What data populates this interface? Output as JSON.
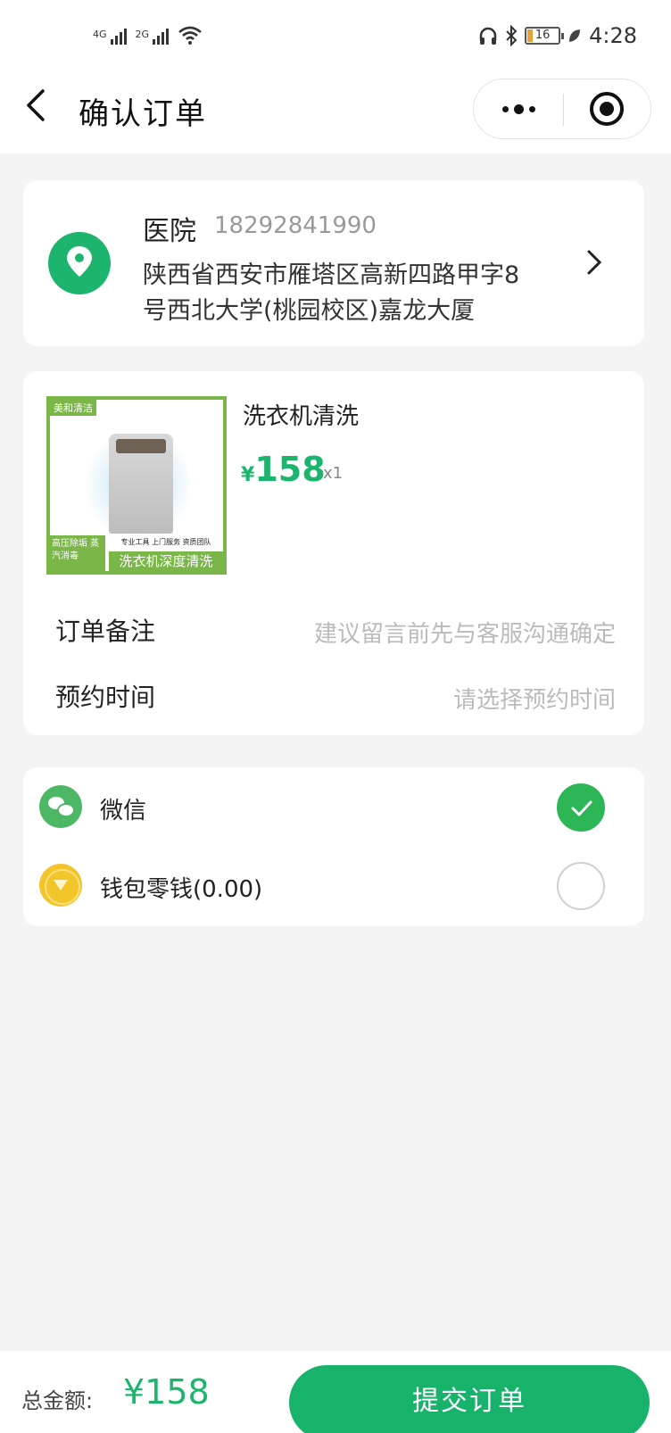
{
  "status_bar": {
    "signal1_label": "4G",
    "signal2_label": "2G",
    "battery_level": "16",
    "time": "4:28"
  },
  "nav": {
    "title": "确认订单",
    "icons": [
      "back-chevron-icon",
      "more-dots-icon",
      "close-miniprogram-icon"
    ]
  },
  "address": {
    "name": "医院",
    "phone": "18292841990",
    "line1": "陕西省西安市雁塔区高新四路甲字8",
    "line2": "号西北大学(桃园校区)嘉龙大厦",
    "icon": "location-pin-icon"
  },
  "product": {
    "title": "洗衣机清洗",
    "currency": "¥",
    "price": "158",
    "quantity": "x1",
    "image_text": {
      "tag": "美和清洁",
      "badge": "高压除垢 蒸汽消毒",
      "features": "专业工具  上门服务  资质团队",
      "caption": "洗衣机深度清洗"
    }
  },
  "order_fields": {
    "note_label": "订单备注",
    "note_placeholder": "建议留言前先与客服沟通确定",
    "time_label": "预约时间",
    "time_placeholder": "请选择预约时间"
  },
  "payment": {
    "options": [
      {
        "label": "微信",
        "icon": "wechat-icon",
        "selected": true
      },
      {
        "label": "钱包零钱(0.00)",
        "icon": "wallet-coin-icon",
        "selected": false
      }
    ]
  },
  "footer": {
    "total_label": "总金额:",
    "total_amount": "¥158",
    "submit_label": "提交订单"
  },
  "colors": {
    "accent": "#1db56d",
    "check": "#2db655",
    "background": "#f4f4f4"
  }
}
